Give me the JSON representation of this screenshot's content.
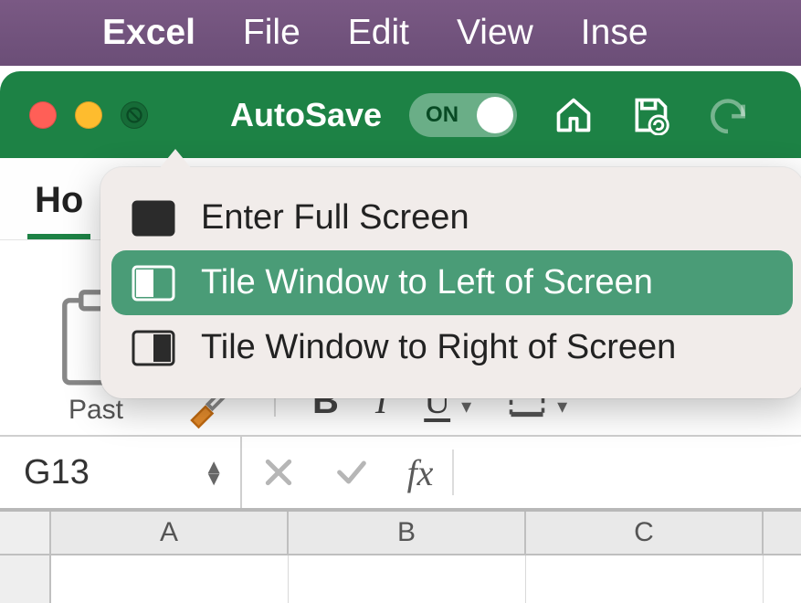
{
  "menubar": {
    "app_name": "Excel",
    "items": [
      "File",
      "Edit",
      "View",
      "Inse"
    ]
  },
  "titlebar": {
    "autosave_label": "AutoSave",
    "autosave_state": "ON"
  },
  "ribbon": {
    "active_tab_truncated": "Ho",
    "clipboard_label_truncated": "Past",
    "font_bold": "B",
    "font_italic": "I",
    "font_underline": "U"
  },
  "popover": {
    "items": [
      {
        "label": "Enter Full Screen",
        "icon": "fullscreen",
        "selected": false
      },
      {
        "label": "Tile Window to Left of Screen",
        "icon": "tile-left",
        "selected": true
      },
      {
        "label": "Tile Window to Right of Screen",
        "icon": "tile-right",
        "selected": false
      }
    ]
  },
  "formula_bar": {
    "name_box": "G13",
    "fx_label": "fx"
  },
  "sheet": {
    "columns": [
      "A",
      "B",
      "C"
    ]
  }
}
